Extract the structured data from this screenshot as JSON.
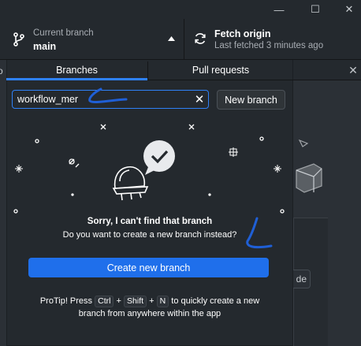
{
  "window": {
    "minimize_glyph": "—",
    "maximize_glyph": "☐",
    "close_glyph": "✕"
  },
  "toolbar": {
    "current_branch_label": "Current branch",
    "current_branch_value": "main",
    "fetch_title": "Fetch origin",
    "fetch_subtitle": "Last fetched 3 minutes ago"
  },
  "tabs": {
    "branches": "Branches",
    "pull_requests": "Pull requests"
  },
  "search": {
    "value": "workflow_mer"
  },
  "buttons": {
    "new_branch": "New branch",
    "create_new_branch": "Create new branch"
  },
  "empty_state": {
    "title": "Sorry, I can't find that branch",
    "subtitle": "Do you want to create a new branch instead?"
  },
  "protip": {
    "prefix": "ProTip! Press",
    "key_ctrl": "Ctrl",
    "plus1": "+",
    "key_shift": "Shift",
    "plus2": "+",
    "key_n": "N",
    "suffix": "to quickly create a new branch from anywhere within the app"
  },
  "background": {
    "partial_left_text": "o",
    "partial_button_text": "de"
  },
  "colors": {
    "accent": "#2f81f7",
    "primary_button": "#1f6feb",
    "annotation": "#1f5fd6"
  },
  "icons": {
    "branch": "git-branch-icon",
    "caret": "triangle-up-icon",
    "fetch": "sync-icon",
    "clear": "x-icon",
    "illustration": "lightbulb-check-icon"
  }
}
